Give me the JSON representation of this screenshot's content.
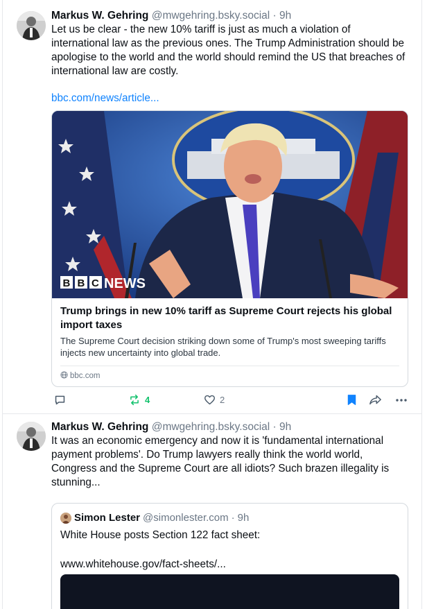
{
  "post1": {
    "author_name": "Markus W. Gehring",
    "handle": "@mwgehring.bsky.social",
    "separator": "·",
    "time": "9h",
    "text": "Let us be clear - the new 10% tariff is just as much a violation of international law as the previous ones. The Trump Administration should be apologise to the world and the world should remind the US that breaches of international law are costly.",
    "link_text": "bbc.com/news/article...",
    "card": {
      "brand_text": "NEWS",
      "bbc_letters": [
        "B",
        "B",
        "C"
      ],
      "title": "Trump brings in new 10% tariff as Supreme Court rejects his global import taxes",
      "description": "The Supreme Court decision striking down some of Trump's most sweeping tariffs injects new uncertainty into global trade.",
      "domain": "bbc.com"
    },
    "actions": {
      "reposts": "4",
      "likes": "2"
    }
  },
  "post2": {
    "author_name": "Markus W. Gehring",
    "handle": "@mwgehring.bsky.social",
    "separator": "·",
    "time": "9h",
    "text": "It was an economic emergency and now it is 'fundamental international payment problems'. Do Trump lawyers really think the world world, Congress and the Supreme Court are all idiots? Such brazen illegality is stunning...",
    "quote": {
      "author_name": "Simon Lester",
      "handle": "@simonlester.com",
      "separator": "·",
      "time": "9h",
      "text": "White House posts Section 122 fact sheet:",
      "url": "www.whitehouse.gov/fact-sheets/..."
    }
  },
  "colors": {
    "link": "#1083fe",
    "repost_active": "#13c26d",
    "bookmark_active": "#1083fe",
    "muted": "#6b7785"
  }
}
